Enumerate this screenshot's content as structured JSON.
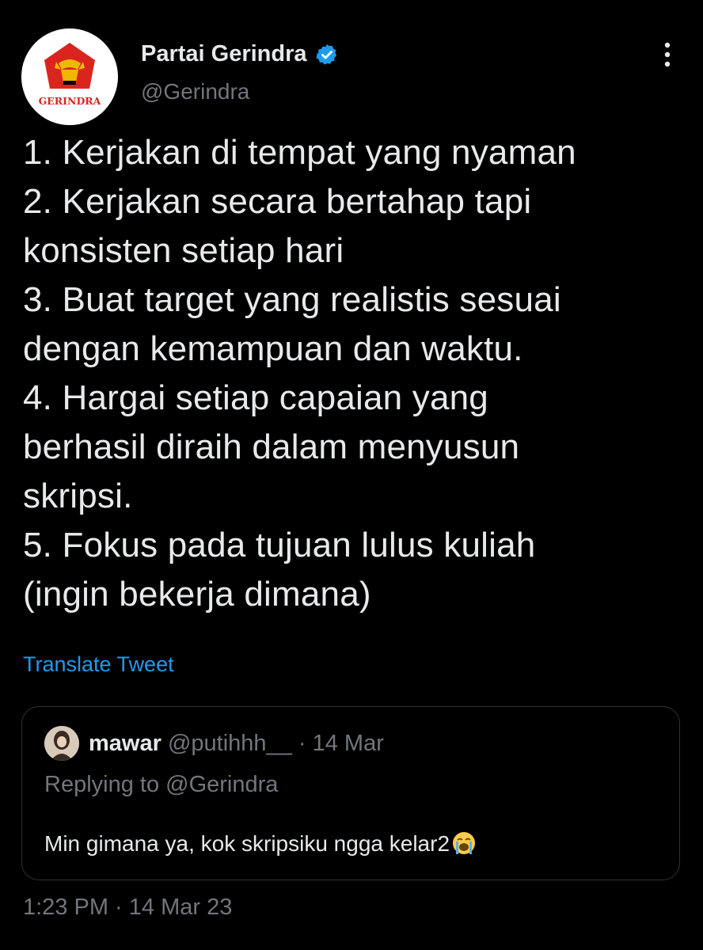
{
  "author": {
    "display_name": "Partai Gerindra",
    "handle": "@Gerindra",
    "verified": true,
    "logo_text": "GERINDRA",
    "verified_color": "#1d9bf0"
  },
  "tweet": {
    "text": "1. Kerjakan di tempat yang nyaman\n2. Kerjakan secara bertahap tapi\nkonsisten setiap hari\n3. Buat target yang realistis sesuai\ndengan kemampuan dan waktu.\n4. Hargai setiap capaian yang\nberhasil diraih dalam menyusun\nskripsi.\n5. Fokus pada tujuan lulus kuliah\n(ingin bekerja dimana)",
    "translate_label": "Translate Tweet",
    "timestamp": "1:23 PM · 14 Mar 23"
  },
  "quoted": {
    "display_name": "mawar",
    "handle": "@putihhh__",
    "separator": "·",
    "date": "14 Mar",
    "replying_to": "Replying to @Gerindra",
    "text": "Min gimana ya, kok skripsiku ngga kelar2",
    "emoji": "loudly-crying-face-emoji"
  },
  "icons": {
    "more": "more-vertical-icon",
    "verified": "verified-badge-icon"
  },
  "colors": {
    "background": "#000000",
    "text": "#e7e9ea",
    "muted": "#71767b",
    "link": "#1d9bf0",
    "border": "#2f3336"
  }
}
